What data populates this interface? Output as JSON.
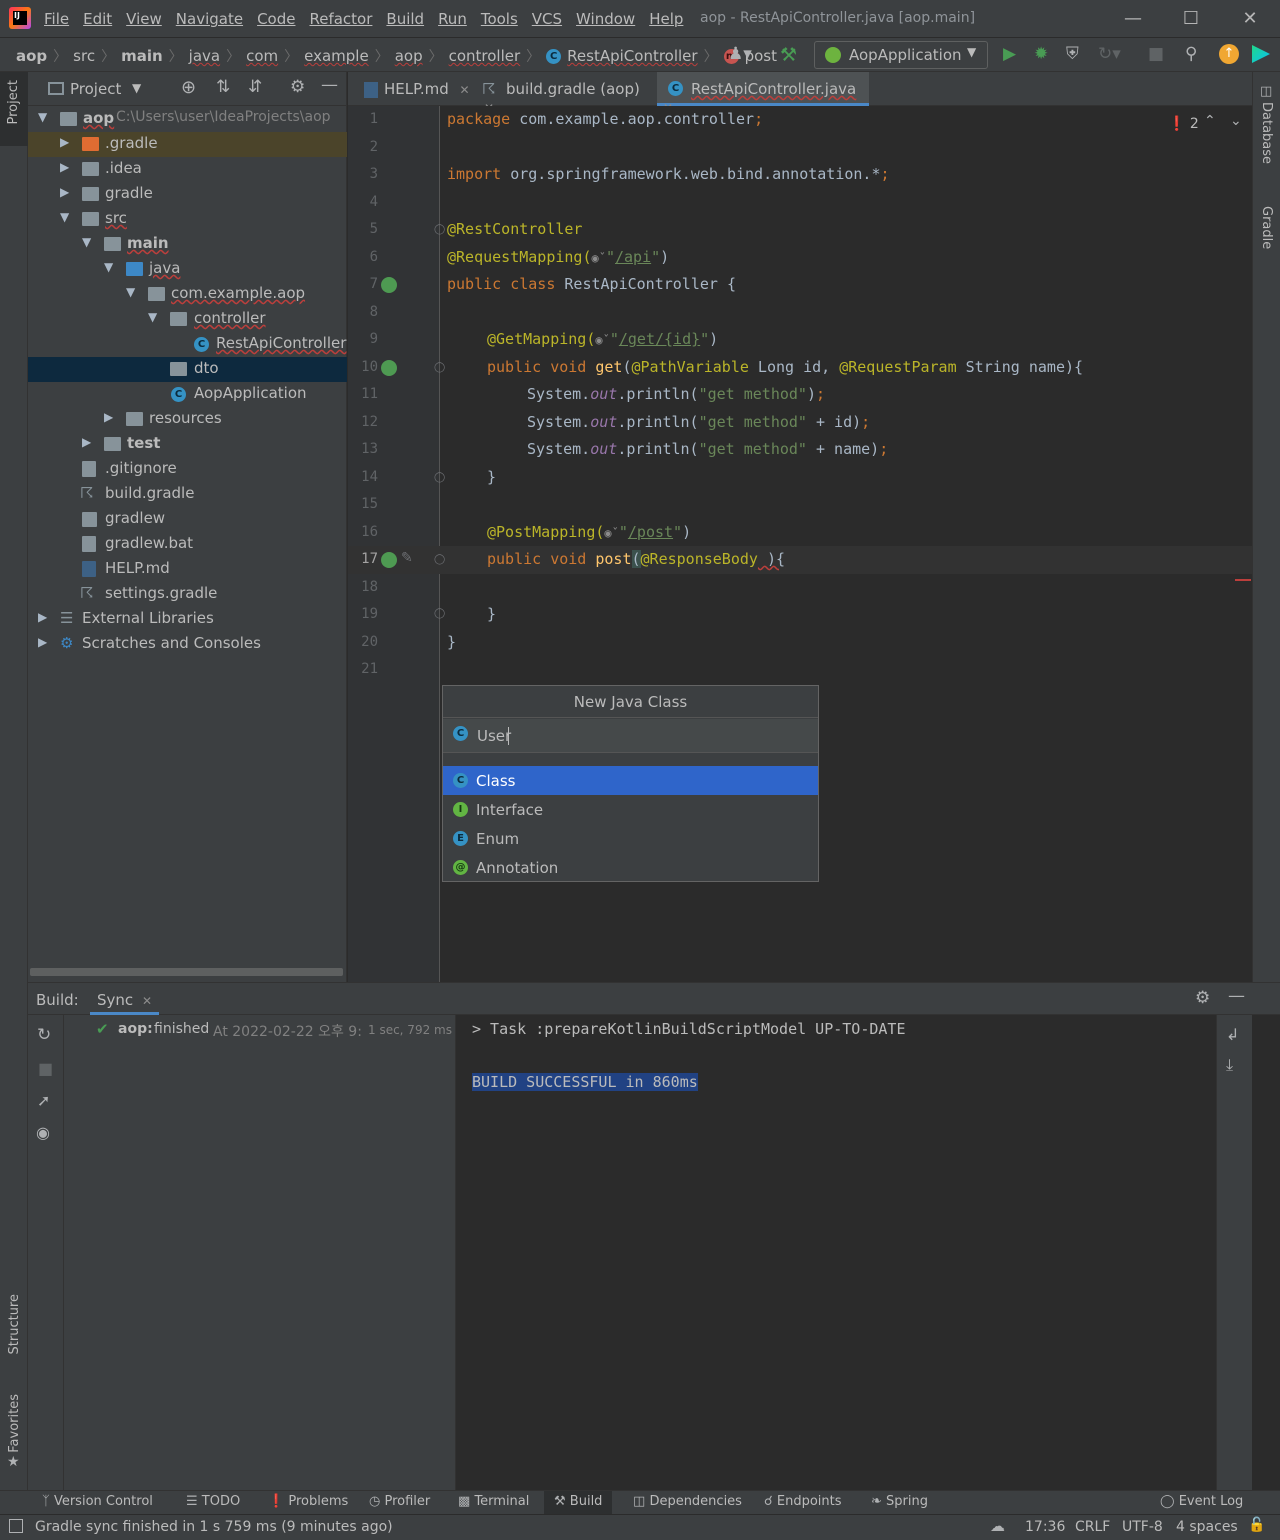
{
  "window": {
    "title": "aop - RestApiController.java [aop.main]"
  },
  "menu": [
    "File",
    "Edit",
    "View",
    "Navigate",
    "Code",
    "Refactor",
    "Build",
    "Run",
    "Tools",
    "VCS",
    "Window",
    "Help"
  ],
  "breadcrumbs": [
    "aop",
    "src",
    "main",
    "java",
    "com",
    "example",
    "aop",
    "controller",
    "RestApiController",
    "post"
  ],
  "run_config": "AopApplication",
  "project_panel": {
    "title": "Project",
    "root_name": "aop",
    "root_path": "C:\\Users\\user\\IdeaProjects\\aop",
    "items": [
      ".gradle",
      ".idea",
      "gradle",
      "src",
      "main",
      "java",
      "com.example.aop",
      "controller",
      "RestApiController",
      "dto",
      "AopApplication",
      "resources",
      "test",
      ".gitignore",
      "build.gradle",
      "gradlew",
      "gradlew.bat",
      "HELP.md",
      "settings.gradle",
      "External Libraries",
      "Scratches and Consoles"
    ]
  },
  "tabs": [
    "HELP.md",
    "build.gradle (aop)",
    "RestApiController.java"
  ],
  "editor": {
    "error_count": "2",
    "line_numbers": [
      "1",
      "2",
      "3",
      "4",
      "5",
      "6",
      "7",
      "8",
      "9",
      "10",
      "11",
      "12",
      "13",
      "14",
      "15",
      "16",
      "17",
      "18",
      "19",
      "20",
      "21"
    ],
    "code": {
      "l1_kw": "package",
      "l1_rest": " com.example.aop.controller",
      "l3_kw": "import",
      "l3_rest": " org.springframework.web.bind.annotation.*",
      "semi": ";",
      "l5": "@RestController",
      "l6_an": "@RequestMapping(",
      "l6_url": "/api",
      "l7_kw": "public class",
      "l7_rest": " RestApiController {",
      "l9_an": "@GetMapping(",
      "l9_url": "/get/{id}",
      "l10_kw": "public void",
      "l10_fn": "get",
      "l10_a1": "@PathVariable",
      "l10_t1": " Long id, ",
      "l10_a2": "@RequestParam",
      "l10_t2": " String name){",
      "sysout_a": "System.",
      "sysout_out": "out",
      "sysout_b": ".println(",
      "l11_str": "\"get method\"",
      "l12_str": "\"get method\"",
      "l12_rest": " + id)",
      "l13_str": "\"get method\"",
      "l13_rest": " + name)",
      "close_brace": "}",
      "l16_an": "@PostMapping(",
      "l16_url": "/post",
      "l17_kw": "public void",
      "l17_fn": "post",
      "l17_an": "@ResponseBody",
      "l17_rest": " ){"
    }
  },
  "popup": {
    "title": "New Java Class",
    "input_value": "User",
    "options": [
      "Class",
      "Interface",
      "Enum",
      "Annotation"
    ],
    "selected": "Class"
  },
  "build": {
    "tab_label": "Build:",
    "sync_tab": "Sync",
    "tree_title": "aop:",
    "tree_status": "finished",
    "tree_time": "At 2022-02-22 오후 9:",
    "tree_duration": "1 sec, 792 ms",
    "console_line1": "> Task :prepareKotlinBuildScriptModel UP-TO-DATE",
    "console_line2": "BUILD SUCCESSFUL in 860ms"
  },
  "side_tools": {
    "left_top": "Project",
    "left_structure": "Structure",
    "left_favorites": "Favorites",
    "right_database": "Database",
    "right_gradle": "Gradle"
  },
  "bottom_tools": [
    "Version Control",
    "TODO",
    "Problems",
    "Profiler",
    "Terminal",
    "Build",
    "Dependencies",
    "Endpoints",
    "Spring",
    "Event Log"
  ],
  "status": {
    "message": "Gradle sync finished in 1 s 759 ms (9 minutes ago)",
    "position": "17:36",
    "line_sep": "CRLF",
    "encoding": "UTF-8",
    "indent": "4 spaces"
  },
  "colors": {
    "accent": "#4a88c7",
    "selection": "#2f65ca",
    "keyword": "#cc7832",
    "annotation": "#bbb529",
    "string": "#6a8759"
  }
}
